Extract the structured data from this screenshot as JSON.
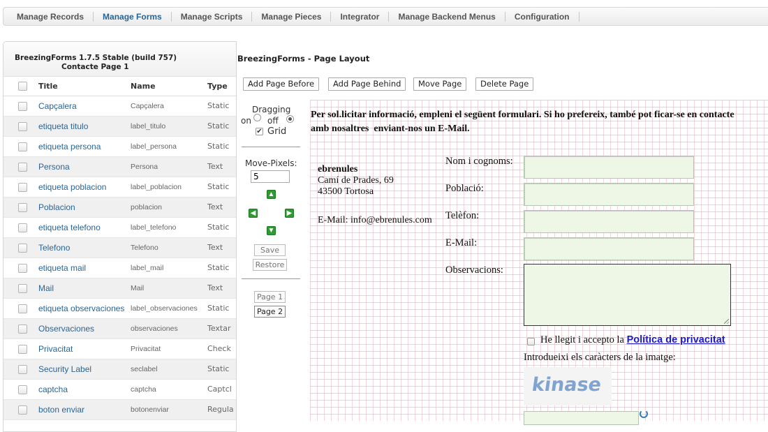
{
  "nav": {
    "items": [
      {
        "label": "Manage Records",
        "active": false
      },
      {
        "label": "Manage Forms",
        "active": true
      },
      {
        "label": "Manage Scripts",
        "active": false
      },
      {
        "label": "Manage Pieces",
        "active": false
      },
      {
        "label": "Integrator",
        "active": false
      },
      {
        "label": "Manage Backend Menus",
        "active": false
      },
      {
        "label": "Configuration",
        "active": false
      }
    ]
  },
  "left_panel": {
    "title": "BreezingForms 1.7.5 Stable (build 757)",
    "subtitle": "Contacte Page 1",
    "columns": {
      "title": "Title",
      "name": "Name",
      "type": "Type"
    },
    "rows": [
      {
        "title": "Capçalera",
        "name": "Capçalera",
        "type": "Static"
      },
      {
        "title": "etiqueta titulo",
        "name": "label_titulo",
        "type": "Static"
      },
      {
        "title": "etiqueta persona",
        "name": "label_persona",
        "type": "Static"
      },
      {
        "title": "Persona",
        "name": "Persona",
        "type": "Text"
      },
      {
        "title": "etiqueta poblacion",
        "name": "label_poblacion",
        "type": "Static"
      },
      {
        "title": "Poblacion",
        "name": "poblacion",
        "type": "Text"
      },
      {
        "title": "etiqueta telefono",
        "name": "label_telefono",
        "type": "Static"
      },
      {
        "title": "Telefono",
        "name": "Telefono",
        "type": "Text"
      },
      {
        "title": "etiqueta mail",
        "name": "label_mail",
        "type": "Static"
      },
      {
        "title": "Mail",
        "name": "Mail",
        "type": "Text"
      },
      {
        "title": "etiqueta observaciones",
        "name": "label_observaciones",
        "type": "Static"
      },
      {
        "title": "Observaciones",
        "name": "observaciones",
        "type": "Textar"
      },
      {
        "title": "Privacitat",
        "name": "Privacitat",
        "type": "Check"
      },
      {
        "title": "Security Label",
        "name": "seclabel",
        "type": "Static"
      },
      {
        "title": "captcha",
        "name": "captcha",
        "type": "Captcl"
      },
      {
        "title": "boton enviar",
        "name": "botonenviar",
        "type": "Regula"
      }
    ]
  },
  "layout": {
    "title": "BreezingForms - Page Layout",
    "buttons": {
      "add_before": "Add Page Before",
      "add_behind": "Add Page Behind",
      "move": "Move Page",
      "delete": "Delete Page"
    }
  },
  "controls": {
    "dragging_label": "Dragging",
    "on_label": "on",
    "off_label": "off",
    "dragging_value": "off",
    "grid_label": "Grid",
    "grid_checked": true,
    "move_pixels_label": "Move-Pixels:",
    "move_pixels_value": "5",
    "save_label": "Save",
    "restore_label": "Restore",
    "pages": [
      "Page 1",
      "Page 2"
    ]
  },
  "form": {
    "intro_line1": "Per sol.licitar informació, empleni el següent formulari. Si ho prefereix, també pot ficar-se en contacte",
    "intro_line2": "amb nosaltres  enviant-nos un E-Mail.",
    "company": "ebrenules",
    "address1": "Camí de Prades, 69",
    "address2": "43500 Tortosa",
    "email_line": "E-Mail: info@ebrenules.com",
    "fields": [
      {
        "label": "Nom i cognoms:"
      },
      {
        "label": "Població:"
      },
      {
        "label": "Telèfon:"
      },
      {
        "label": "E-Mail:"
      },
      {
        "label": "Observacions:"
      }
    ],
    "privacy_text": "He llegit i accepto la ",
    "privacy_link": "Política de privacitat",
    "captcha_label": "Introdueixi els caràcters de la imatge:",
    "captcha_text": "kinase"
  }
}
